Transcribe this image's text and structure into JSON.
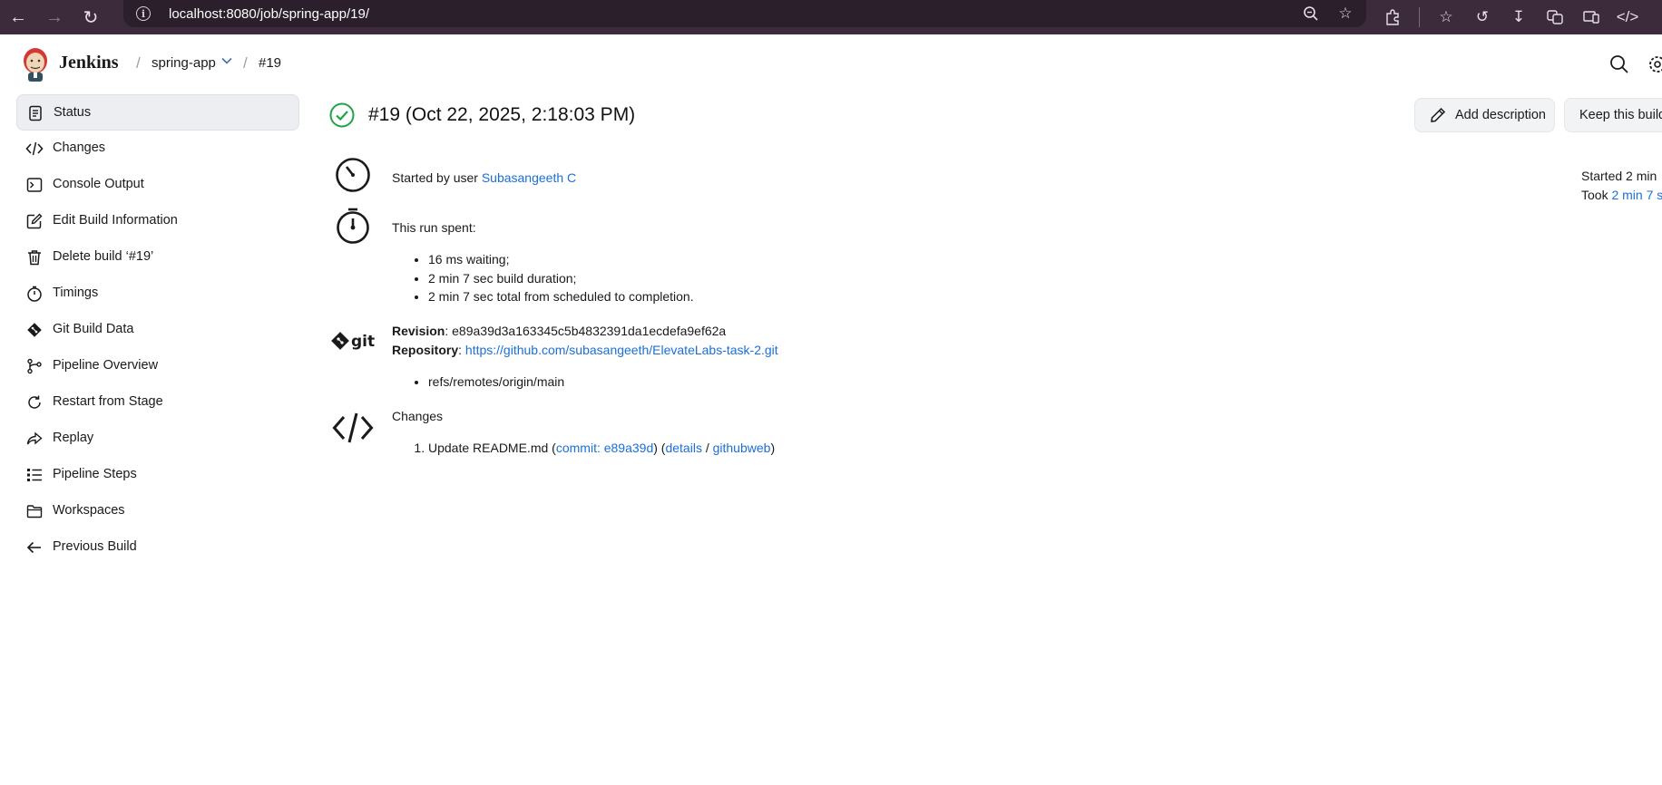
{
  "browser": {
    "url": "localhost:8080/job/spring-app/19/"
  },
  "header": {
    "brand": "Jenkins",
    "breadcrumbs": [
      {
        "label": "spring-app"
      },
      {
        "label": "#19"
      }
    ]
  },
  "sidebar": {
    "items": [
      {
        "label": "Status",
        "icon": "document-icon",
        "active": true
      },
      {
        "label": "Changes",
        "icon": "code-icon"
      },
      {
        "label": "Console Output",
        "icon": "terminal-icon"
      },
      {
        "label": "Edit Build Information",
        "icon": "edit-icon"
      },
      {
        "label": "Delete build ‘#19’",
        "icon": "trash-icon"
      },
      {
        "label": "Timings",
        "icon": "stopwatch-icon"
      },
      {
        "label": "Git Build Data",
        "icon": "git-icon"
      },
      {
        "label": "Pipeline Overview",
        "icon": "pipeline-icon"
      },
      {
        "label": "Restart from Stage",
        "icon": "restart-icon"
      },
      {
        "label": "Replay",
        "icon": "replay-icon"
      },
      {
        "label": "Pipeline Steps",
        "icon": "list-icon"
      },
      {
        "label": "Workspaces",
        "icon": "folder-icon"
      },
      {
        "label": "Previous Build",
        "icon": "arrow-left-icon"
      }
    ]
  },
  "build": {
    "title": "#19 (Oct 22, 2025, 2:18:03 PM)",
    "status_color": "#1ea446",
    "add_description": "Add description",
    "keep_build": "Keep this build",
    "started_by_prefix": "Started by user ",
    "started_by_user": "Subasangeeth C",
    "run_spent_label": "This run spent:",
    "run_spent": [
      "16 ms waiting;",
      "2 min 7 sec build duration;",
      "2 min 7 sec total from scheduled to completion."
    ],
    "revision_label": "Revision",
    "revision": "e89a39d3a163345c5b4832391da1ecdefa9ef62a",
    "repository_label": "Repository",
    "repository": "https://github.com/subasangeeth/ElevateLabs-task-2.git",
    "branches": [
      "refs/remotes/origin/main"
    ],
    "changes_label": "Changes",
    "changes": [
      {
        "message": "Update README.md",
        "commit_label": "commit: e89a39d",
        "details": "details",
        "githubweb": "githubweb"
      }
    ],
    "started_ago": "Started 2 min",
    "took_prefix": "Took ",
    "took": "2 min 7 s"
  },
  "colors": {
    "link": "#1a6fd8",
    "browser_bar": "#3b2b3b"
  }
}
